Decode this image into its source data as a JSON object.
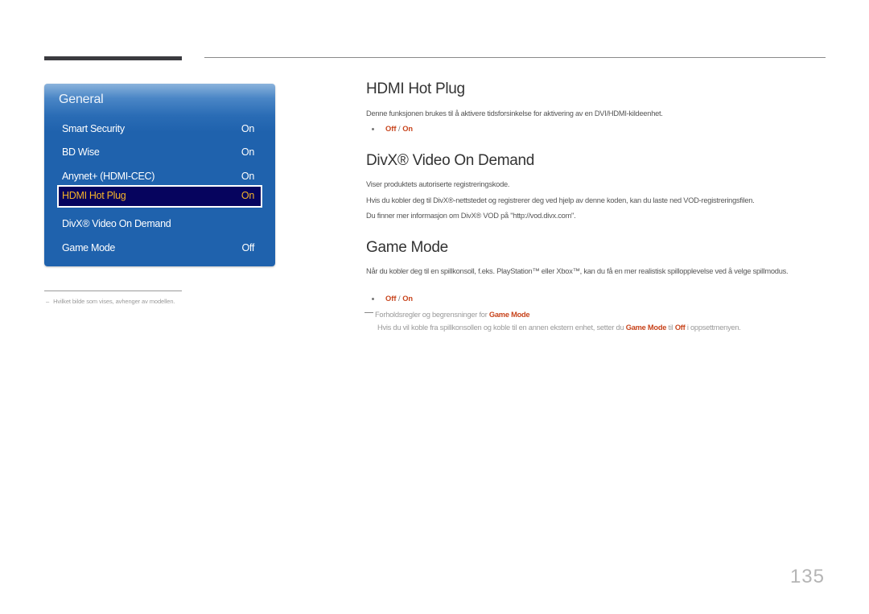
{
  "menu": {
    "title": "General",
    "items": [
      {
        "label": "Smart Security",
        "value": "On",
        "selected": false
      },
      {
        "label": "BD Wise",
        "value": "On",
        "selected": false
      },
      {
        "label": "Anynet+ (HDMI-CEC)",
        "value": "On",
        "selected": false
      },
      {
        "label": "HDMI Hot Plug",
        "value": "On",
        "selected": true
      },
      {
        "label": "DivX® Video On Demand",
        "value": "",
        "selected": false
      },
      {
        "label": "Game Mode",
        "value": "Off",
        "selected": false
      }
    ]
  },
  "footnote": {
    "dash": "–",
    "text": "Hvilket bilde som vises, avhenger av modellen."
  },
  "sections": {
    "hdmi": {
      "title": "HDMI Hot Plug",
      "description": "Denne funksjonen brukes til å aktivere tidsforsinkelse for aktivering av en DVI/HDMI-kildeenhet.",
      "option_off": "Off",
      "option_sep": " / ",
      "option_on": "On"
    },
    "divx": {
      "title": "DivX® Video On Demand",
      "line1": "Viser produktets autoriserte registreringskode.",
      "line2": "Hvis du kobler deg til DivX®-nettstedet og registrerer deg ved hjelp av denne koden, kan du laste ned VOD-registreringsfilen.",
      "line3": "Du finner mer informasjon om DivX® VOD på \"http://vod.divx.com\"."
    },
    "game": {
      "title": "Game Mode",
      "description": "Når du kobler deg til en spillkonsoll, f.eks. PlayStation™ eller Xbox™, kan du få en mer realistisk spillopplevelse ved å velge spillmodus.",
      "option_off": "Off",
      "option_sep": " / ",
      "option_on": "On",
      "note_prefix": "Forholdsregler og begrensninger for ",
      "note_accent": "Game Mode",
      "detail_part1": "Hvis du  vil koble fra spillkonsollen og koble til en annen ekstern enhet, setter du ",
      "detail_accent1": "Game Mode",
      "detail_part2": " til ",
      "detail_accent2": "Off",
      "detail_part3": " i oppsettmenyen."
    }
  },
  "page_number": "135",
  "colors": {
    "accent": "#c8441c",
    "menu_blue": "#1f62ad",
    "selected_bg": "#06045e",
    "selected_text": "#f4b42a"
  }
}
